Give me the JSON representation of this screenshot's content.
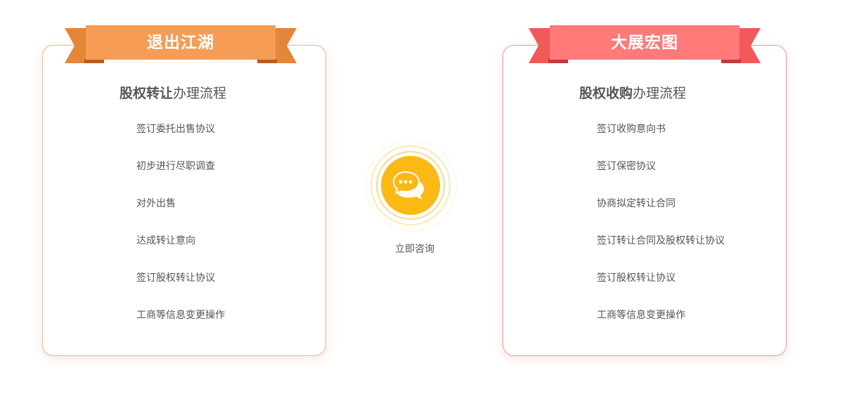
{
  "left_panel": {
    "ribbon_title": "退出江湖",
    "title_bold": "股权转让",
    "title_rest": "办理流程",
    "steps": [
      "签订委托出售协议",
      "初步进行尽职调查",
      "对外出售",
      "达成转让意向",
      "签订股权转让协议",
      "工商等信息变更操作"
    ],
    "accent_color": "#f69c55",
    "fold_color": "#e07d32"
  },
  "right_panel": {
    "ribbon_title": "大展宏图",
    "title_bold": "股权收购",
    "title_rest": "办理流程",
    "steps": [
      "签订收购意向书",
      "签订保密协议",
      "协商拟定转让合同",
      "签订转让合同及股权转让协议",
      "签订股权转让协议",
      "工商等信息变更操作"
    ],
    "accent_color": "#ff7a78",
    "fold_color": "#f25a5a"
  },
  "consult": {
    "label": "立即咨询",
    "icon": "chat-bubbles-icon",
    "color": "#fdb913"
  }
}
